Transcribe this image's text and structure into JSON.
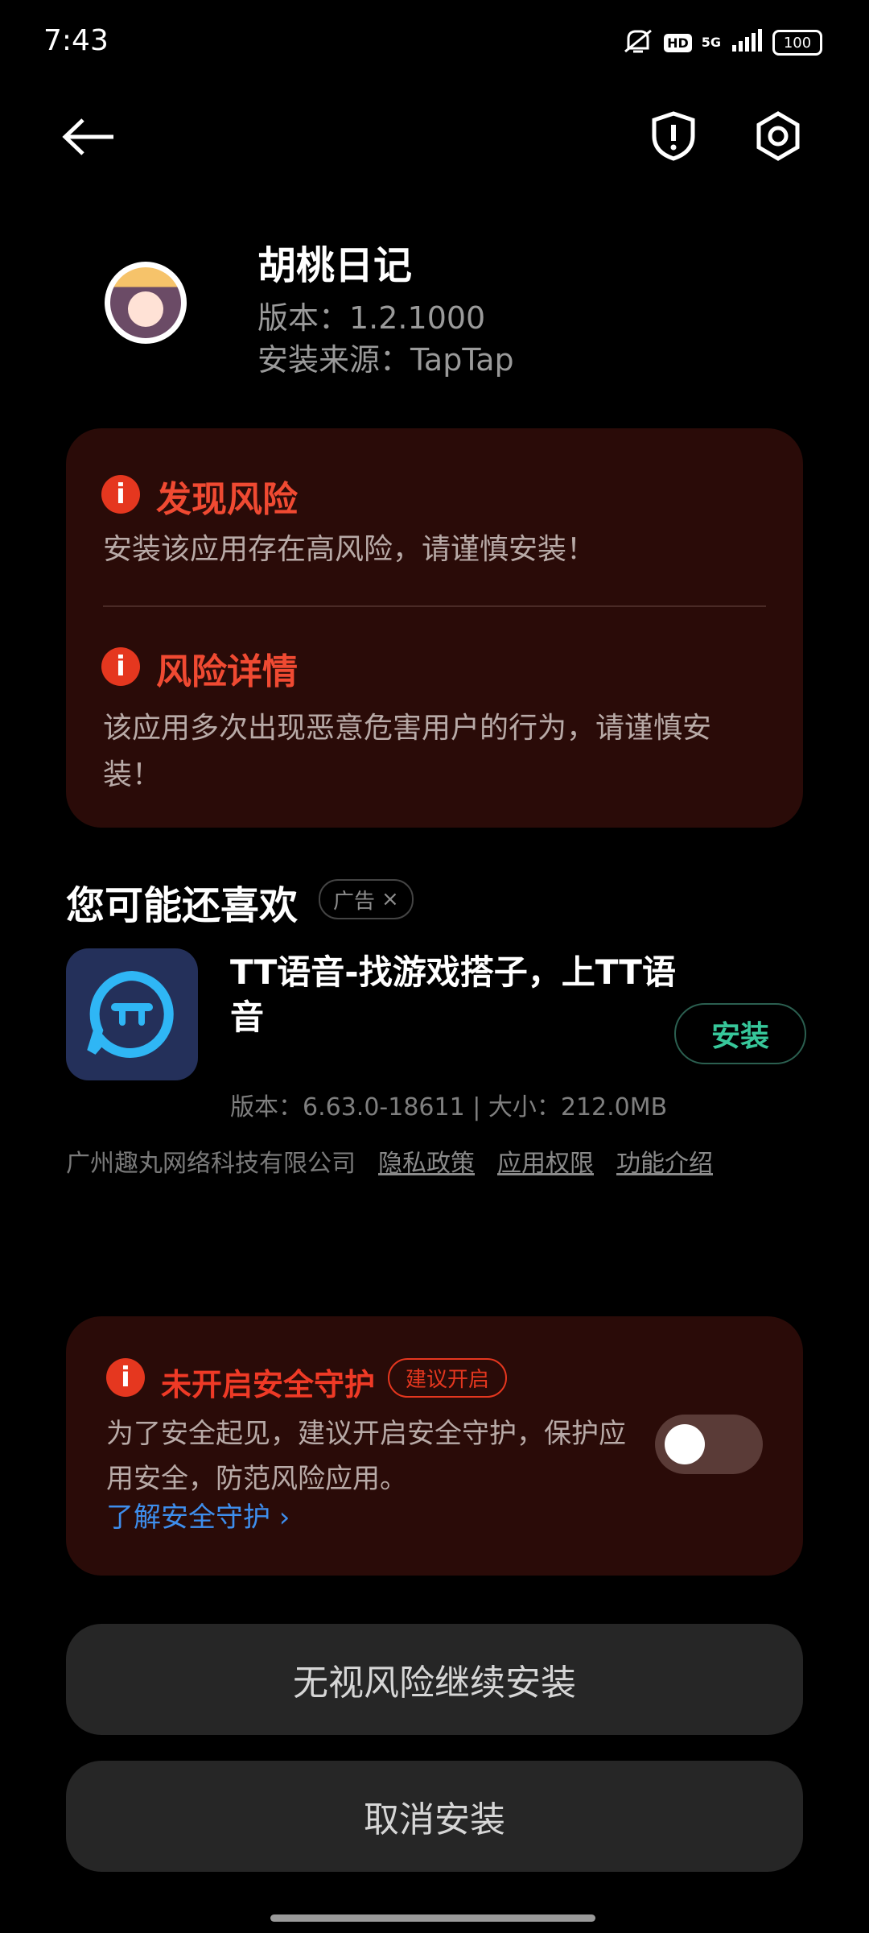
{
  "status_bar": {
    "time": "7:43",
    "hd": "HD",
    "network": "5G",
    "battery": "100"
  },
  "header": {
    "back_icon": "arrow-left-icon",
    "shield_icon": "shield-alert-icon",
    "settings_icon": "hexagon-settings-icon"
  },
  "app": {
    "name": "胡桃日记",
    "version": "版本：1.2.1000",
    "source": "安装来源：TapTap"
  },
  "risk_card": {
    "found_title": "发现风险",
    "found_text": "安装该应用存在高风险，请谨慎安装！",
    "detail_title": "风险详情",
    "detail_text": "该应用多次出现恶意危害用户的行为，请谨慎安装！"
  },
  "recommend": {
    "title": "您可能还喜欢",
    "ad_label": "广告",
    "ad_close": "×",
    "app_name": "TT语音-找游戏搭子，上TT语音",
    "install": "安装",
    "meta": "版本：6.63.0-18611 | 大小：212.0MB",
    "company": "广州趣丸网络科技有限公司",
    "links": [
      "隐私政策",
      "应用权限",
      "功能介绍"
    ]
  },
  "protection": {
    "title": "未开启安全守护",
    "suggest": "建议开启",
    "desc": "为了安全起见，建议开启安全守护，保护应用安全，防范风险应用。",
    "learn_more": "了解安全守护 ›",
    "toggle_on": false
  },
  "buttons": {
    "continue": "无视风险继续安装",
    "cancel": "取消安装"
  },
  "colors": {
    "risk_red": "#e5371f",
    "card_bg": "#2a0b08",
    "install_green": "#37c79a",
    "link_blue": "#3e8eed"
  }
}
